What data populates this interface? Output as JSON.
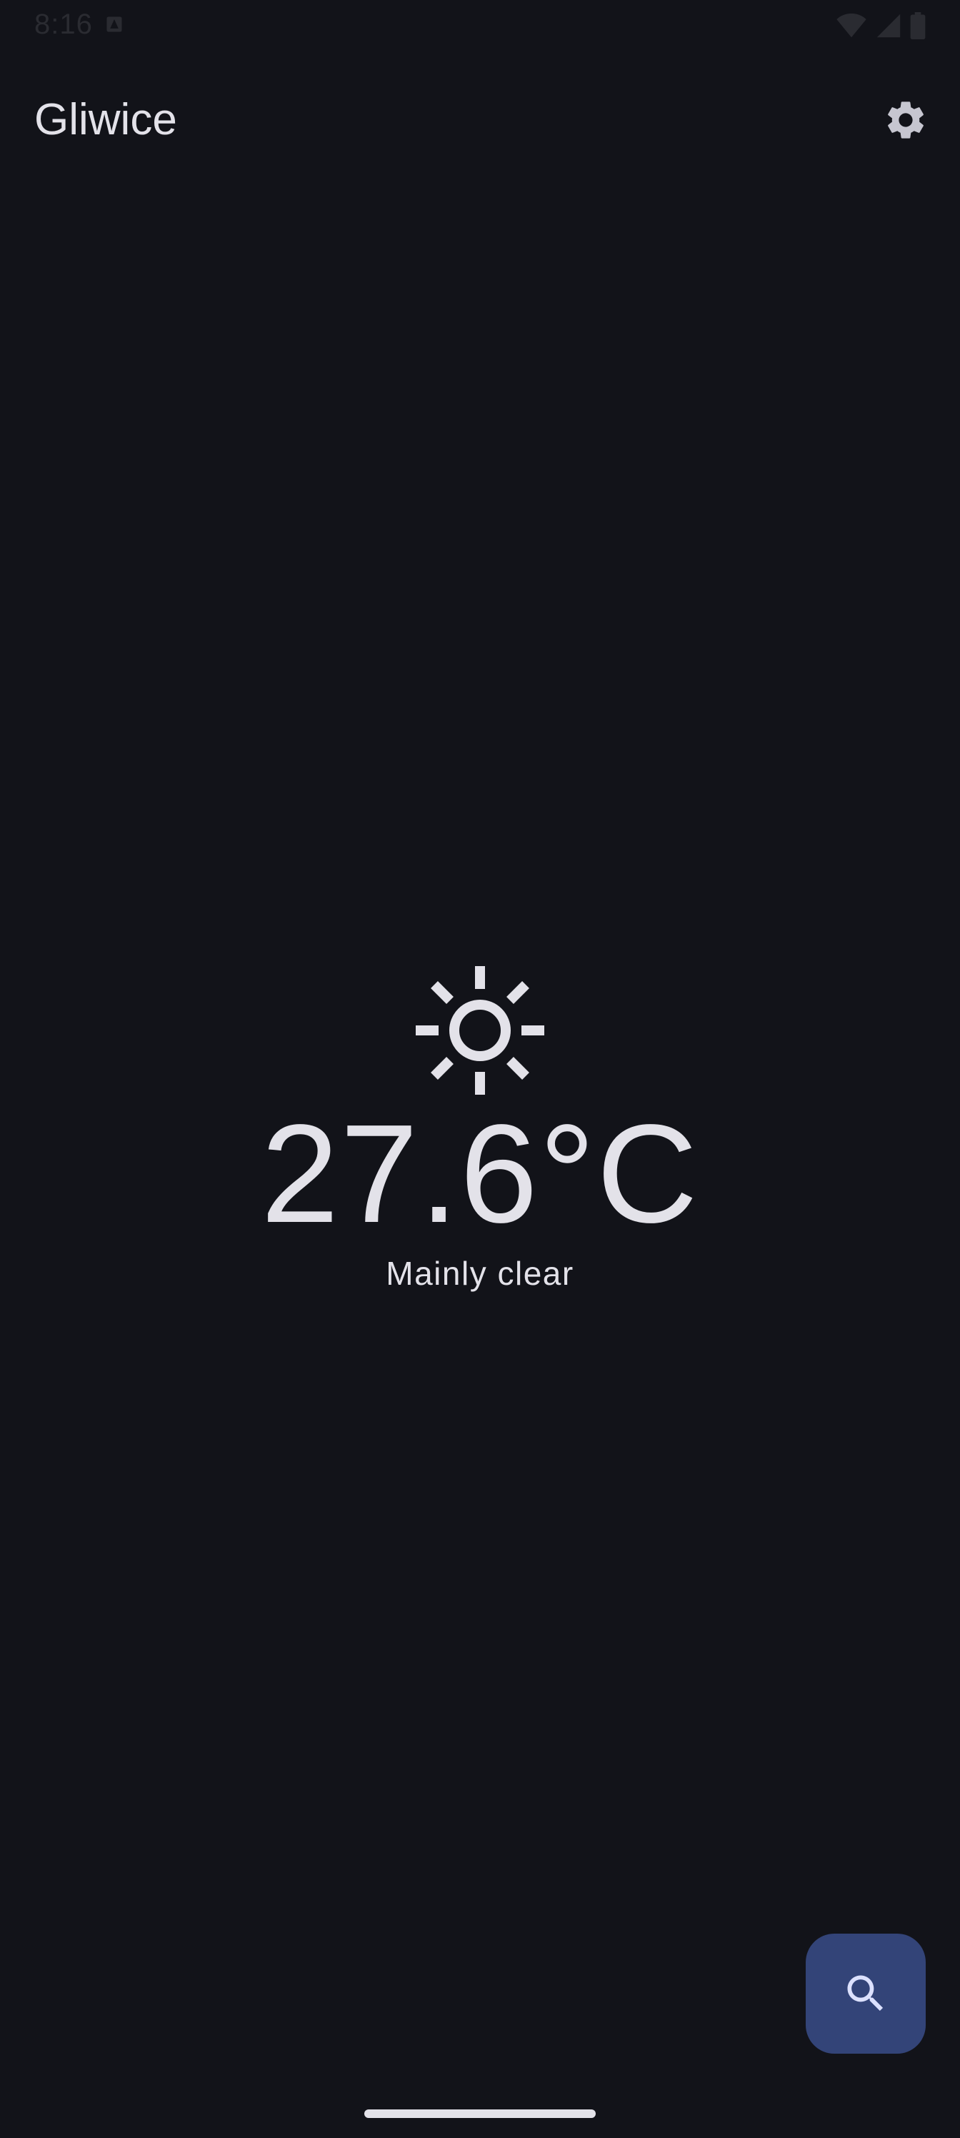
{
  "status_bar": {
    "time": "8:16",
    "notification_icon": "notification-icon",
    "icons": [
      "wifi-icon",
      "signal-icon",
      "battery-icon"
    ]
  },
  "app_bar": {
    "title": "Gliwice",
    "settings_icon": "gear-icon"
  },
  "weather": {
    "icon": "sun-icon",
    "temperature": "27.6°C",
    "condition": "Mainly clear"
  },
  "fab": {
    "icon": "search-icon",
    "color": "#334478"
  },
  "colors": {
    "background": "#121319",
    "on_surface": "#e3e2e9",
    "primary_container": "#334478"
  }
}
